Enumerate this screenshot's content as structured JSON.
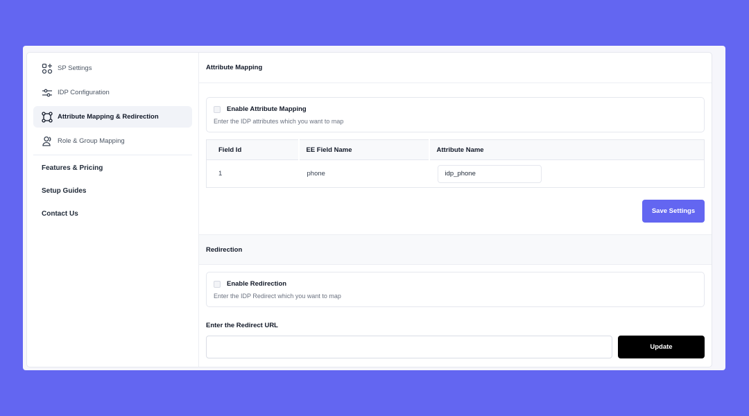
{
  "sidebar": {
    "items": [
      {
        "label": "SP Settings",
        "icon": "grid-plus-icon",
        "active": false
      },
      {
        "label": "IDP Configuration",
        "icon": "sliders-icon",
        "active": false
      },
      {
        "label": "Attribute Mapping & Redirection",
        "icon": "nodes-icon",
        "active": true
      },
      {
        "label": "Role & Group Mapping",
        "icon": "users-icon",
        "active": false
      }
    ],
    "links": [
      {
        "label": "Features & Pricing"
      },
      {
        "label": "Setup Guides"
      },
      {
        "label": "Contact Us"
      }
    ]
  },
  "attribute_mapping": {
    "title": "Attribute Mapping",
    "enable_label": "Enable Attribute Mapping",
    "enabled": false,
    "description": "Enter the IDP attributes which you want to map",
    "table": {
      "headers": [
        "Field Id",
        "EE Field Name",
        "Attribute Name"
      ],
      "rows": [
        {
          "field_id": "1",
          "ee_field_name": "phone",
          "attribute_name": "idp_phone"
        }
      ]
    },
    "save_label": "Save Settings"
  },
  "redirection": {
    "title": "Redirection",
    "enable_label": "Enable Redirection",
    "enabled": false,
    "description": "Enter the IDP Redirect which you want to map",
    "url_label": "Enter the Redirect URL",
    "url_value": "",
    "update_label": "Update"
  },
  "colors": {
    "background": "#6366f1",
    "accent": "#6366f1",
    "update_button": "#000000",
    "active_nav": "#f1f3f8"
  }
}
